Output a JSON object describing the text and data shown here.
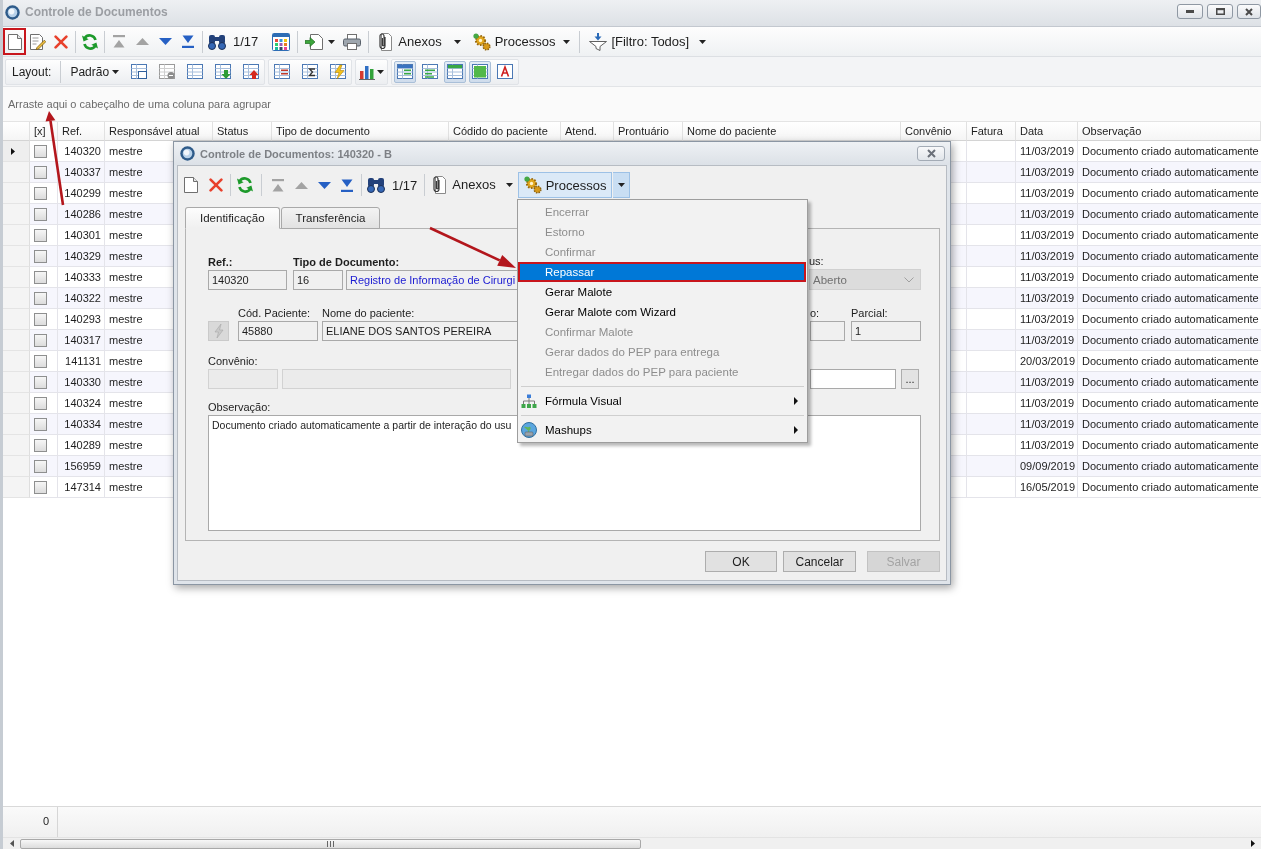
{
  "window": {
    "title": "Controle de Documentos"
  },
  "toolbar": {
    "new_marked": true,
    "at_first_record": true,
    "record_counter": "1/17",
    "attachments": "Anexos",
    "processes": "Processos",
    "filter": "[Filtro: Todos]"
  },
  "layout_bar": {
    "label": "Layout:",
    "preset": "Padrão",
    "view_toggles": [
      {
        "on": true
      },
      {
        "on": false
      },
      {
        "on": true
      },
      {
        "on": true
      },
      {
        "on": false
      }
    ]
  },
  "group_panel": {
    "hint": "Arraste aqui o cabeçalho de uma coluna para agrupar"
  },
  "grid": {
    "columns": [
      "[x]",
      "Ref.",
      "Responsável atual",
      "Status",
      "Tipo de documento",
      "Códido do paciente",
      "Atend.",
      "Prontuário",
      "Nome do paciente",
      "Convênio",
      "Fatura",
      "Data",
      "Observação"
    ],
    "rows": [
      {
        "current": true,
        "checked": false,
        "ref": "140320",
        "responsible": "mestre",
        "date": "11/03/2019",
        "observation": "Documento criado automaticamente"
      },
      {
        "current": false,
        "checked": false,
        "ref": "140337",
        "responsible": "mestre",
        "date": "11/03/2019",
        "observation": "Documento criado automaticamente"
      },
      {
        "current": false,
        "checked": false,
        "ref": "140299",
        "responsible": "mestre",
        "date": "11/03/2019",
        "observation": "Documento criado automaticamente"
      },
      {
        "current": false,
        "checked": false,
        "ref": "140286",
        "responsible": "mestre",
        "date": "11/03/2019",
        "observation": "Documento criado automaticamente"
      },
      {
        "current": false,
        "checked": false,
        "ref": "140301",
        "responsible": "mestre",
        "date": "11/03/2019",
        "observation": "Documento criado automaticamente"
      },
      {
        "current": false,
        "checked": false,
        "ref": "140329",
        "responsible": "mestre",
        "date": "11/03/2019",
        "observation": "Documento criado automaticamente"
      },
      {
        "current": false,
        "checked": false,
        "ref": "140333",
        "responsible": "mestre",
        "date": "11/03/2019",
        "observation": "Documento criado automaticamente"
      },
      {
        "current": false,
        "checked": false,
        "ref": "140322",
        "responsible": "mestre",
        "date": "11/03/2019",
        "observation": "Documento criado automaticamente"
      },
      {
        "current": false,
        "checked": false,
        "ref": "140293",
        "responsible": "mestre",
        "date": "11/03/2019",
        "observation": "Documento criado automaticamente"
      },
      {
        "current": false,
        "checked": false,
        "ref": "140317",
        "responsible": "mestre",
        "date": "11/03/2019",
        "observation": "Documento criado automaticamente"
      },
      {
        "current": false,
        "checked": false,
        "ref": "141131",
        "responsible": "mestre",
        "date": "20/03/2019",
        "observation": "Documento criado automaticamente"
      },
      {
        "current": false,
        "checked": false,
        "ref": "140330",
        "responsible": "mestre",
        "date": "11/03/2019",
        "observation": "Documento criado automaticamente"
      },
      {
        "current": false,
        "checked": false,
        "ref": "140324",
        "responsible": "mestre",
        "date": "11/03/2019",
        "observation": "Documento criado automaticamente"
      },
      {
        "current": false,
        "checked": false,
        "ref": "140334",
        "responsible": "mestre",
        "date": "11/03/2019",
        "observation": "Documento criado automaticamente"
      },
      {
        "current": false,
        "checked": false,
        "ref": "140289",
        "responsible": "mestre",
        "date": "11/03/2019",
        "observation": "Documento criado automaticamente"
      },
      {
        "current": false,
        "checked": false,
        "ref": "156959",
        "responsible": "mestre",
        "date": "09/09/2019",
        "observation": "Documento criado automaticamente"
      },
      {
        "current": false,
        "checked": false,
        "ref": "147314",
        "responsible": "mestre",
        "date": "16/05/2019",
        "observation": "Documento criado automaticamente"
      }
    ],
    "footer_count": "0"
  },
  "dialog": {
    "title": "Controle de Documentos: 140320 - B",
    "toolbar": {
      "at_first_record": true,
      "record_counter": "1/17",
      "attachments": "Anexos",
      "processes": "Processos",
      "processes_open": true
    },
    "tabs": [
      {
        "label": "Identificação",
        "selected": true
      },
      {
        "label": "Transferência",
        "selected": false
      }
    ],
    "form": {
      "ref": {
        "label": "Ref.:",
        "required": true,
        "value": "140320"
      },
      "document_type": {
        "label": "Tipo de Documento:",
        "required": true,
        "code": "16",
        "name": "Registro de Informação de Cirurgi"
      },
      "status": {
        "label": "us:",
        "value": "Aberto",
        "disabled": true
      },
      "patient_code": {
        "label": "Cód. Paciente:",
        "value": "45880",
        "lookup_disabled": true
      },
      "patient_name": {
        "label": "Nome do paciente:",
        "value": "ELIANE DOS SANTOS PEREIRA"
      },
      "field_6": {
        "label": "o:"
      },
      "partial": {
        "label": "Parcial:",
        "value": "1"
      },
      "insurance": {
        "label": "Convênio:",
        "disabled": true
      },
      "field_9": {
        "button": "..."
      },
      "observation": {
        "label": "Observação:",
        "value": "Documento criado automaticamente a partir de interação do usu"
      }
    },
    "buttons": [
      {
        "label": "OK",
        "disabled": false
      },
      {
        "label": "Cancelar",
        "disabled": false
      },
      {
        "label": "Salvar",
        "disabled": true
      }
    ],
    "processes_menu": {
      "items": [
        {
          "kind": "action",
          "label": "Encerrar",
          "disabled": true,
          "selected": false,
          "marked": false
        },
        {
          "kind": "action",
          "label": "Estorno",
          "disabled": true,
          "selected": false,
          "marked": false
        },
        {
          "kind": "action",
          "label": "Confirmar",
          "disabled": true,
          "selected": false,
          "marked": false
        },
        {
          "kind": "action",
          "label": "Repassar",
          "disabled": false,
          "selected": true,
          "marked": true
        },
        {
          "kind": "action",
          "label": "Gerar Malote",
          "disabled": false,
          "selected": false,
          "marked": false
        },
        {
          "kind": "action",
          "label": "Gerar Malote com Wizard",
          "disabled": false,
          "selected": false,
          "marked": false
        },
        {
          "kind": "action",
          "label": "Confirmar Malote",
          "disabled": true,
          "selected": false,
          "marked": false
        },
        {
          "kind": "action",
          "label": "Gerar dados do PEP para entrega",
          "disabled": true,
          "selected": false,
          "marked": false
        },
        {
          "kind": "action",
          "label": "Entregar dados do PEP para paciente",
          "disabled": true,
          "selected": false,
          "marked": false
        },
        {
          "kind": "submenu",
          "label": "Fórmula Visual",
          "disabled": false,
          "selected": false,
          "marked": false
        },
        {
          "kind": "submenu",
          "label": "Mashups",
          "disabled": false,
          "selected": false,
          "marked": false
        }
      ]
    }
  }
}
